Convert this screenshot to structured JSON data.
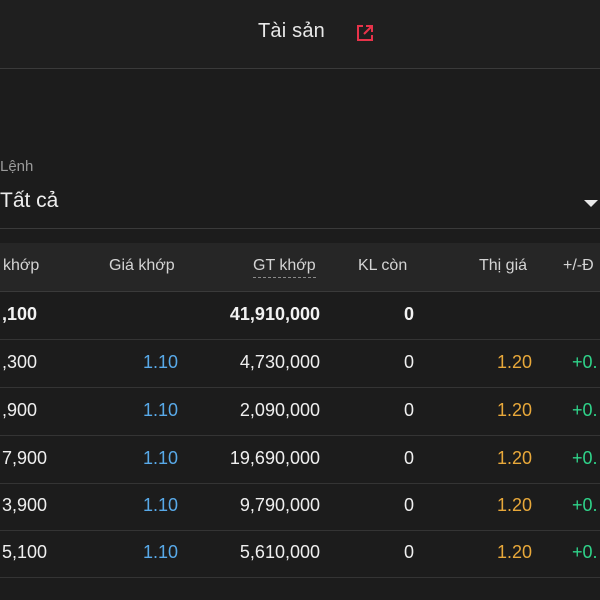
{
  "header": {
    "title": "Tài sản"
  },
  "filter": {
    "label": "Lệnh",
    "value": "Tất cả"
  },
  "table": {
    "columns": [
      "khớp",
      "Giá khớp",
      "GT khớp",
      "KL còn",
      "Thị giá",
      "+/-Đ"
    ],
    "summary": {
      "kl": ",100",
      "gt": "41,910,000",
      "con": "0"
    },
    "rows": [
      {
        "kl": ",300",
        "price": "1.10",
        "gt": "4,730,000",
        "con": "0",
        "market": "1.20",
        "change": "+0."
      },
      {
        "kl": ",900",
        "price": "1.10",
        "gt": "2,090,000",
        "con": "0",
        "market": "1.20",
        "change": "+0."
      },
      {
        "kl": "7,900",
        "price": "1.10",
        "gt": "19,690,000",
        "con": "0",
        "market": "1.20",
        "change": "+0."
      },
      {
        "kl": "3,900",
        "price": "1.10",
        "gt": "9,790,000",
        "con": "0",
        "market": "1.20",
        "change": "+0."
      },
      {
        "kl": "5,100",
        "price": "1.10",
        "gt": "5,610,000",
        "con": "0",
        "market": "1.20",
        "change": "+0."
      }
    ]
  },
  "colors": {
    "price": "#58a9e8",
    "market": "#e8a83a",
    "change": "#2fd48a",
    "link_icon": "#e8334a"
  },
  "icons": {
    "header_link": "external-link-icon",
    "filter_caret": "caret-down-icon"
  }
}
